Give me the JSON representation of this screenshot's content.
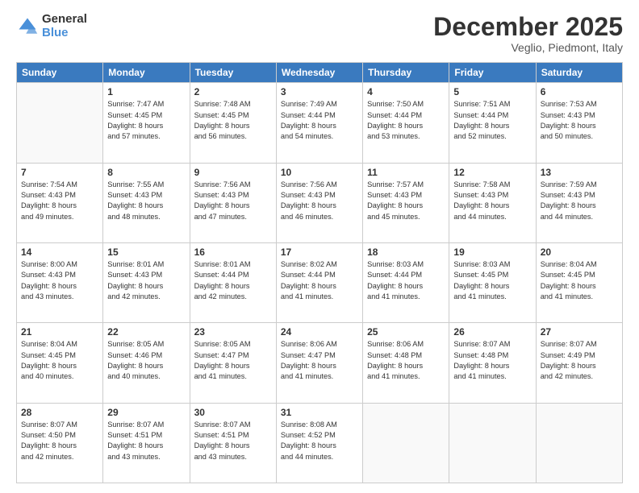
{
  "logo": {
    "general": "General",
    "blue": "Blue"
  },
  "header": {
    "month": "December 2025",
    "location": "Veglio, Piedmont, Italy"
  },
  "weekdays": [
    "Sunday",
    "Monday",
    "Tuesday",
    "Wednesday",
    "Thursday",
    "Friday",
    "Saturday"
  ],
  "weeks": [
    [
      {
        "day": "",
        "info": ""
      },
      {
        "day": "1",
        "info": "Sunrise: 7:47 AM\nSunset: 4:45 PM\nDaylight: 8 hours\nand 57 minutes."
      },
      {
        "day": "2",
        "info": "Sunrise: 7:48 AM\nSunset: 4:45 PM\nDaylight: 8 hours\nand 56 minutes."
      },
      {
        "day": "3",
        "info": "Sunrise: 7:49 AM\nSunset: 4:44 PM\nDaylight: 8 hours\nand 54 minutes."
      },
      {
        "day": "4",
        "info": "Sunrise: 7:50 AM\nSunset: 4:44 PM\nDaylight: 8 hours\nand 53 minutes."
      },
      {
        "day": "5",
        "info": "Sunrise: 7:51 AM\nSunset: 4:44 PM\nDaylight: 8 hours\nand 52 minutes."
      },
      {
        "day": "6",
        "info": "Sunrise: 7:53 AM\nSunset: 4:43 PM\nDaylight: 8 hours\nand 50 minutes."
      }
    ],
    [
      {
        "day": "7",
        "info": "Sunrise: 7:54 AM\nSunset: 4:43 PM\nDaylight: 8 hours\nand 49 minutes."
      },
      {
        "day": "8",
        "info": "Sunrise: 7:55 AM\nSunset: 4:43 PM\nDaylight: 8 hours\nand 48 minutes."
      },
      {
        "day": "9",
        "info": "Sunrise: 7:56 AM\nSunset: 4:43 PM\nDaylight: 8 hours\nand 47 minutes."
      },
      {
        "day": "10",
        "info": "Sunrise: 7:56 AM\nSunset: 4:43 PM\nDaylight: 8 hours\nand 46 minutes."
      },
      {
        "day": "11",
        "info": "Sunrise: 7:57 AM\nSunset: 4:43 PM\nDaylight: 8 hours\nand 45 minutes."
      },
      {
        "day": "12",
        "info": "Sunrise: 7:58 AM\nSunset: 4:43 PM\nDaylight: 8 hours\nand 44 minutes."
      },
      {
        "day": "13",
        "info": "Sunrise: 7:59 AM\nSunset: 4:43 PM\nDaylight: 8 hours\nand 44 minutes."
      }
    ],
    [
      {
        "day": "14",
        "info": "Sunrise: 8:00 AM\nSunset: 4:43 PM\nDaylight: 8 hours\nand 43 minutes."
      },
      {
        "day": "15",
        "info": "Sunrise: 8:01 AM\nSunset: 4:43 PM\nDaylight: 8 hours\nand 42 minutes."
      },
      {
        "day": "16",
        "info": "Sunrise: 8:01 AM\nSunset: 4:44 PM\nDaylight: 8 hours\nand 42 minutes."
      },
      {
        "day": "17",
        "info": "Sunrise: 8:02 AM\nSunset: 4:44 PM\nDaylight: 8 hours\nand 41 minutes."
      },
      {
        "day": "18",
        "info": "Sunrise: 8:03 AM\nSunset: 4:44 PM\nDaylight: 8 hours\nand 41 minutes."
      },
      {
        "day": "19",
        "info": "Sunrise: 8:03 AM\nSunset: 4:45 PM\nDaylight: 8 hours\nand 41 minutes."
      },
      {
        "day": "20",
        "info": "Sunrise: 8:04 AM\nSunset: 4:45 PM\nDaylight: 8 hours\nand 41 minutes."
      }
    ],
    [
      {
        "day": "21",
        "info": "Sunrise: 8:04 AM\nSunset: 4:45 PM\nDaylight: 8 hours\nand 40 minutes."
      },
      {
        "day": "22",
        "info": "Sunrise: 8:05 AM\nSunset: 4:46 PM\nDaylight: 8 hours\nand 40 minutes."
      },
      {
        "day": "23",
        "info": "Sunrise: 8:05 AM\nSunset: 4:47 PM\nDaylight: 8 hours\nand 41 minutes."
      },
      {
        "day": "24",
        "info": "Sunrise: 8:06 AM\nSunset: 4:47 PM\nDaylight: 8 hours\nand 41 minutes."
      },
      {
        "day": "25",
        "info": "Sunrise: 8:06 AM\nSunset: 4:48 PM\nDaylight: 8 hours\nand 41 minutes."
      },
      {
        "day": "26",
        "info": "Sunrise: 8:07 AM\nSunset: 4:48 PM\nDaylight: 8 hours\nand 41 minutes."
      },
      {
        "day": "27",
        "info": "Sunrise: 8:07 AM\nSunset: 4:49 PM\nDaylight: 8 hours\nand 42 minutes."
      }
    ],
    [
      {
        "day": "28",
        "info": "Sunrise: 8:07 AM\nSunset: 4:50 PM\nDaylight: 8 hours\nand 42 minutes."
      },
      {
        "day": "29",
        "info": "Sunrise: 8:07 AM\nSunset: 4:51 PM\nDaylight: 8 hours\nand 43 minutes."
      },
      {
        "day": "30",
        "info": "Sunrise: 8:07 AM\nSunset: 4:51 PM\nDaylight: 8 hours\nand 43 minutes."
      },
      {
        "day": "31",
        "info": "Sunrise: 8:08 AM\nSunset: 4:52 PM\nDaylight: 8 hours\nand 44 minutes."
      },
      {
        "day": "",
        "info": ""
      },
      {
        "day": "",
        "info": ""
      },
      {
        "day": "",
        "info": ""
      }
    ]
  ]
}
